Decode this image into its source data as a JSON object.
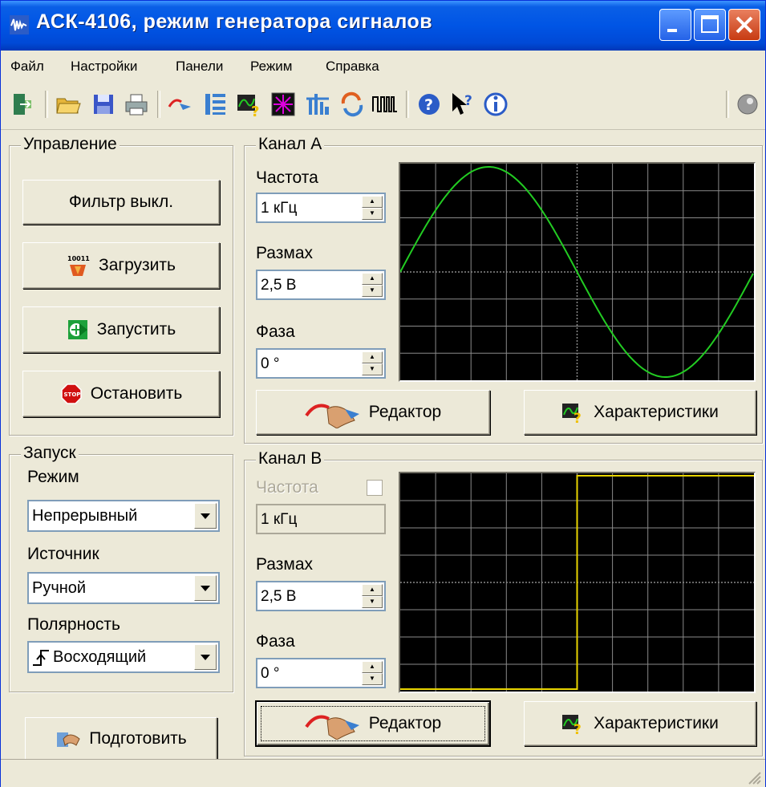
{
  "window": {
    "title": "АСК-4106, режим генератора сигналов"
  },
  "menu": [
    "Файл",
    "Настройки",
    "Панели",
    "Режим",
    "Справка"
  ],
  "toolbar_icons": [
    "exit-icon",
    "open-folder-icon",
    "save-icon",
    "print-icon",
    "signal-editor-icon",
    "channel-settings-icon",
    "characteristics-icon",
    "lissajous-icon",
    "spectrum-icon",
    "sync-icon",
    "pulse-icon",
    "help-icon",
    "context-help-icon",
    "about-icon",
    "status-led-icon"
  ],
  "control": {
    "legend": "Управление",
    "filter_label": "Фильтр выкл.",
    "load_label": "Загрузить",
    "start_label": "Запустить",
    "stop_label": "Остановить"
  },
  "trigger": {
    "legend": "Запуск",
    "mode_label": "Режим",
    "mode_value": "Непрерывный",
    "source_label": "Источник",
    "source_value": "Ручной",
    "polarity_label": "Полярность",
    "polarity_value": "Восходящий",
    "prepare_label": "Подготовить"
  },
  "channel_a": {
    "legend": "Канал А",
    "freq_label": "Частота",
    "freq_value": "1 кГц",
    "amp_label": "Размах",
    "amp_value": "2,5 В",
    "phase_label": "Фаза",
    "phase_value": "0 °",
    "editor_label": "Редактор",
    "chars_label": "Характеристики",
    "waveform": "sine",
    "waveform_color": "#22cc22"
  },
  "channel_b": {
    "legend": "Канал В",
    "freq_label": "Частота",
    "freq_value": "1 кГц",
    "freq_checkbox_checked": false,
    "amp_label": "Размах",
    "amp_value": "2,5 В",
    "phase_label": "Фаза",
    "phase_value": "0 °",
    "editor_label": "Редактор",
    "chars_label": "Характеристики",
    "waveform": "square",
    "waveform_color": "#e8d400"
  },
  "colors": {
    "titlebar": "#0055e5",
    "face": "#ece9d8",
    "scope_bg": "#000000",
    "scope_grid": "#8a8a8a"
  }
}
